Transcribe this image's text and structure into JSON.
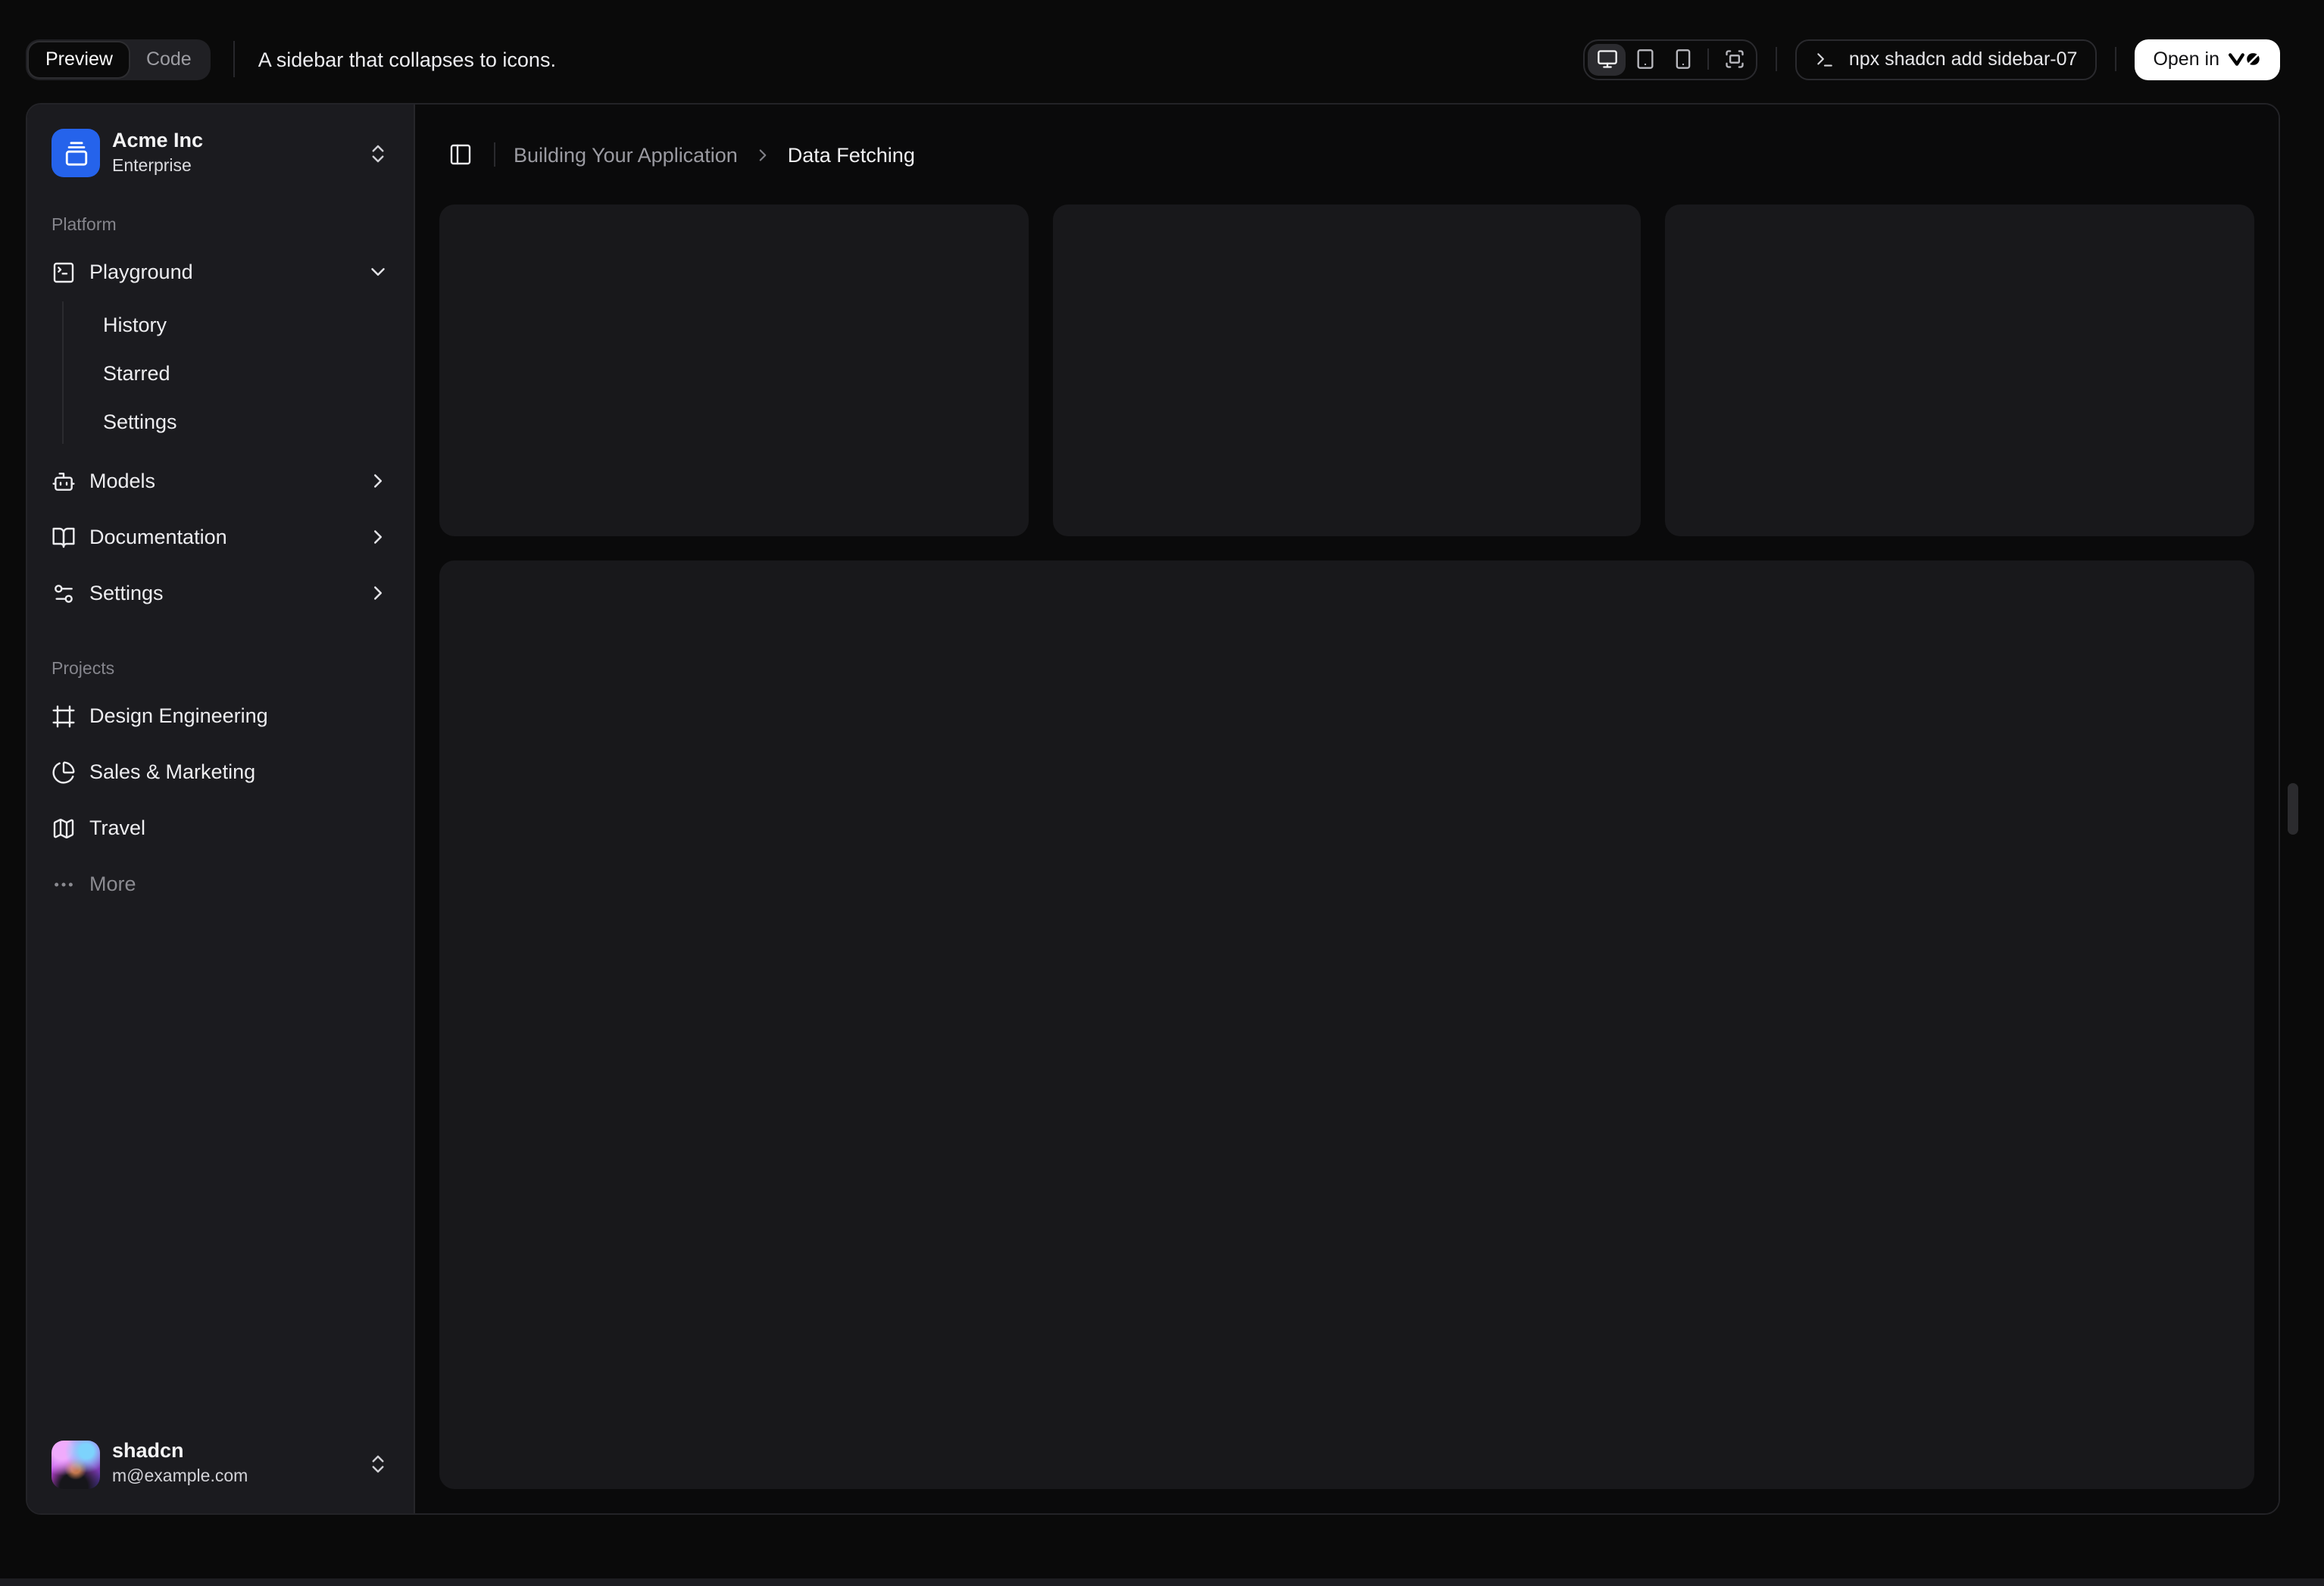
{
  "toolbar": {
    "view_tabs": [
      {
        "label": "Preview",
        "active": true
      },
      {
        "label": "Code",
        "active": false
      }
    ],
    "description": "A sidebar that collapses to icons.",
    "device_toggles": [
      {
        "name": "desktop",
        "icon": "monitor-icon",
        "active": true
      },
      {
        "name": "tablet",
        "icon": "tablet-icon",
        "active": false
      },
      {
        "name": "smartphone",
        "icon": "smartphone-icon",
        "active": false
      },
      {
        "name": "fullscreen",
        "icon": "fullscreen-icon",
        "active": false
      }
    ],
    "command": "npx shadcn add sidebar-07",
    "open_in": {
      "label": "Open in",
      "logo": "v0"
    }
  },
  "sidebar": {
    "team": {
      "name": "Acme Inc",
      "plan": "Enterprise",
      "logo_icon": "gallery-vertical-end",
      "logo_color": "#2563eb"
    },
    "groups": [
      {
        "label": "Platform",
        "items": [
          {
            "label": "Playground",
            "icon": "square-terminal",
            "state": "expanded",
            "children": [
              {
                "label": "History"
              },
              {
                "label": "Starred"
              },
              {
                "label": "Settings"
              }
            ]
          },
          {
            "label": "Models",
            "icon": "bot"
          },
          {
            "label": "Documentation",
            "icon": "book-open"
          },
          {
            "label": "Settings",
            "icon": "settings-2"
          }
        ]
      },
      {
        "label": "Projects",
        "items": [
          {
            "label": "Design Engineering",
            "icon": "frame"
          },
          {
            "label": "Sales & Marketing",
            "icon": "chart-pie"
          },
          {
            "label": "Travel",
            "icon": "map"
          },
          {
            "label": "More",
            "icon": "ellipsis",
            "muted": true
          }
        ]
      }
    ],
    "user": {
      "name": "shadcn",
      "email": "m@example.com"
    }
  },
  "main": {
    "breadcrumb": {
      "parent": "Building Your Application",
      "current": "Data Fetching"
    },
    "placeholders": {
      "top_cards": 3,
      "body_cards": 1
    }
  },
  "colors": {
    "page_bg": "#0a0a0a",
    "main_bg": "#0a0a0b",
    "sidebar_bg": "#1b1b1f",
    "card_bg": "#18181b",
    "border": "#26262a",
    "accent_blue": "#2563eb",
    "open_button_bg": "#ffffff"
  }
}
